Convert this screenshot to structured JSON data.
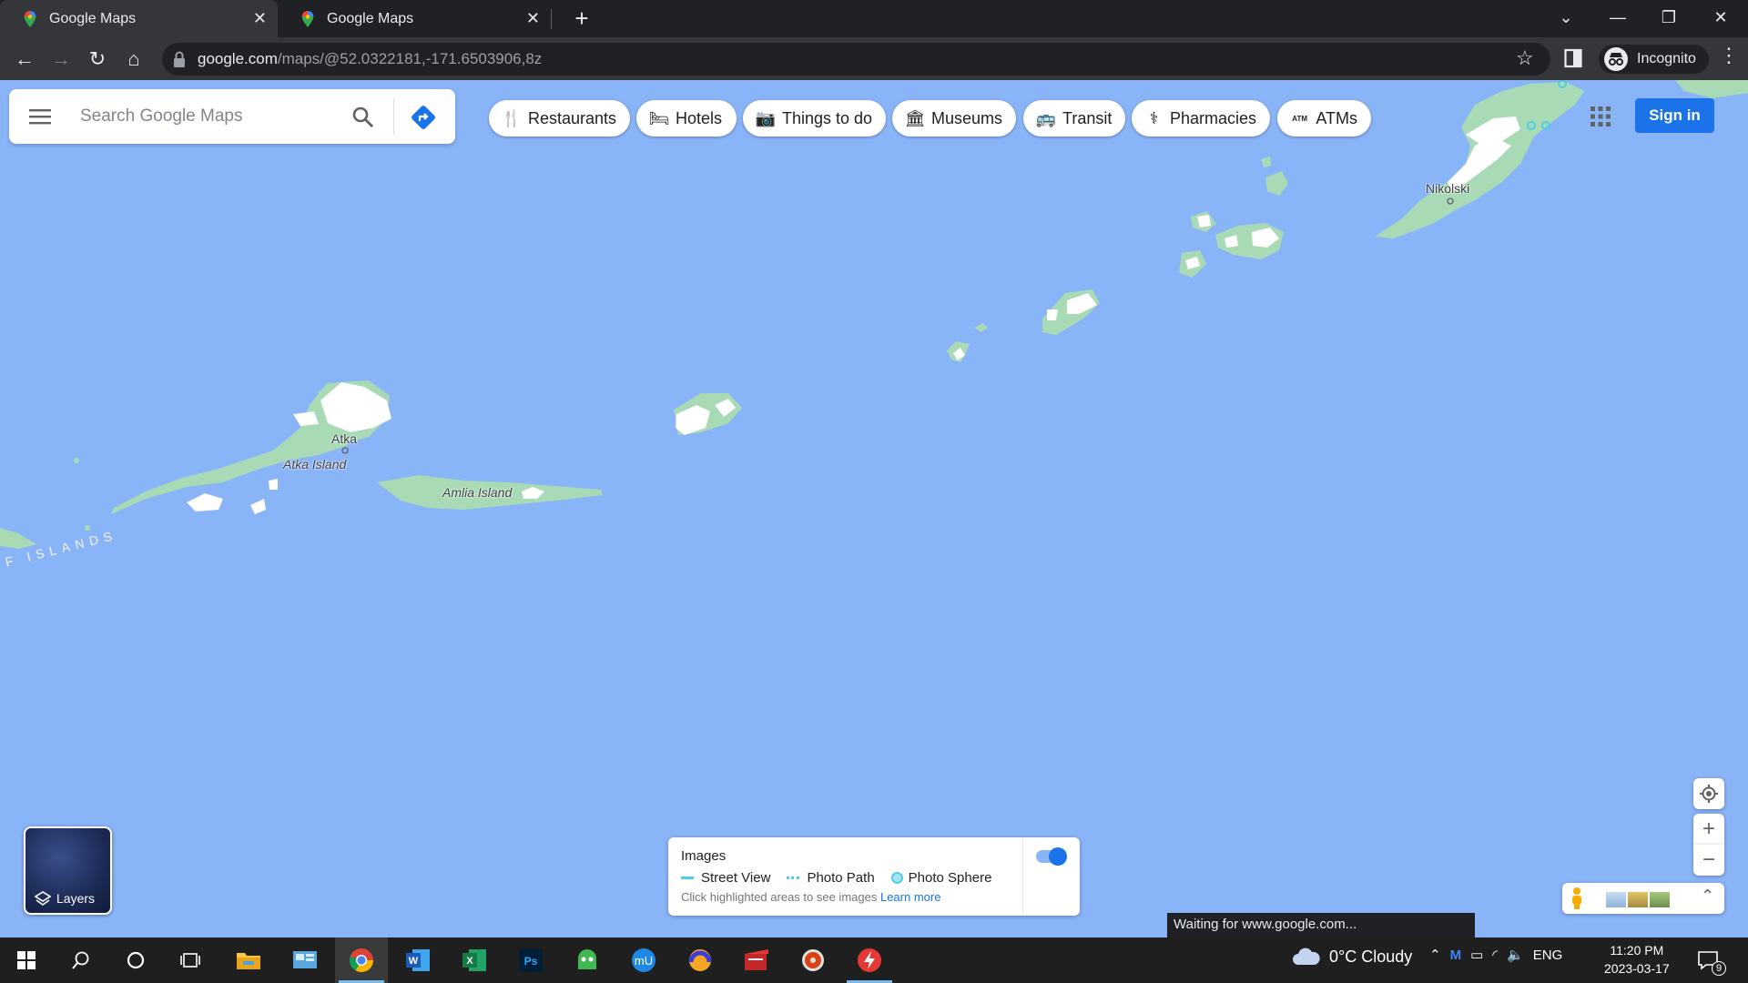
{
  "browser": {
    "tabs": [
      {
        "title": "Google Maps",
        "close_icon": "close-icon"
      },
      {
        "title": "Google Maps",
        "close_icon": "close-icon"
      }
    ],
    "url_host": "google.com",
    "url_path": "/maps/@52.0322181,-171.6503906,8z",
    "profile_label": "Incognito"
  },
  "search": {
    "placeholder": "Search Google Maps"
  },
  "chips": [
    {
      "label": "Restaurants",
      "icon": "fork-knife-icon"
    },
    {
      "label": "Hotels",
      "icon": "bed-icon"
    },
    {
      "label": "Things to do",
      "icon": "camera-icon"
    },
    {
      "label": "Museums",
      "icon": "museum-icon"
    },
    {
      "label": "Transit",
      "icon": "bus-icon"
    },
    {
      "label": "Pharmacies",
      "icon": "pharmacy-icon"
    },
    {
      "label": "ATMs",
      "icon": "atm-icon"
    }
  ],
  "account": {
    "signin_label": "Sign in"
  },
  "map": {
    "labels": {
      "nikolski": "Nikolski",
      "atka": "Atka",
      "atka_island": "Atka Island",
      "amlia_island": "Amlia Island",
      "islands": "F   ISLANDS"
    },
    "colors": {
      "water": "#8ab4f8",
      "land": "#a8dab5",
      "snow": "#ffffff"
    }
  },
  "layers": {
    "label": "Layers"
  },
  "legend": {
    "title": "Images",
    "street_view": "Street View",
    "photo_path": "Photo Path",
    "photo_sphere": "Photo Sphere",
    "hint": "Click highlighted areas to see images",
    "learn_more": "Learn more"
  },
  "status_bar": "Waiting for www.google.com...",
  "taskbar": {
    "weather": "0°C  Cloudy",
    "language": "ENG",
    "time": "11:20 PM",
    "date": "2023-03-17",
    "notification_count": "9"
  }
}
